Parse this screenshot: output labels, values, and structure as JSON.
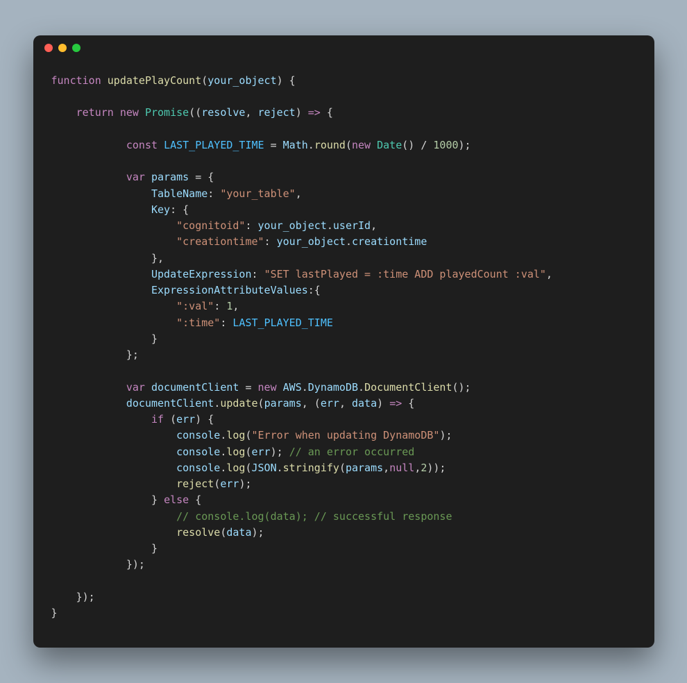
{
  "titlebar": {
    "dots": [
      "red",
      "yellow",
      "green"
    ]
  },
  "code": {
    "t01_kw_function": "function",
    "t02_fn_name": "updatePlayCount",
    "t03_param": "your_object",
    "t04_kw_return": "return",
    "t05_kw_new": "new",
    "t06_cls_promise": "Promise",
    "t07_resolve": "resolve",
    "t08_reject": "reject",
    "t09_kw_const": "const",
    "t10_cst_lpt": "LAST_PLAYED_TIME",
    "t11_id_math": "Math",
    "t12_fn_round": "round",
    "t13_kw_new2": "new",
    "t14_cls_date": "Date",
    "t15_num_1000": "1000",
    "t16_kw_var": "var",
    "t17_id_params": "params",
    "t18_id_tablename": "TableName",
    "t19_str_table": "\"your_table\"",
    "t20_id_key": "Key",
    "t21_str_cognitoid": "\"cognitoid\"",
    "t22_id_yourobj": "your_object",
    "t23_id_userId": "userId",
    "t24_str_creationtime": "\"creationtime\"",
    "t25_id_yourobj2": "your_object",
    "t26_id_creationtime": "creationtime",
    "t27_id_updateexpr": "UpdateExpression",
    "t28_str_updateexpr": "\"SET lastPlayed = :time ADD playedCount :val\"",
    "t29_id_exprattrvals": "ExpressionAttributeValues",
    "t30_str_val": "\":val\"",
    "t31_num_1": "1",
    "t32_str_time": "\":time\"",
    "t33_cst_lpt2": "LAST_PLAYED_TIME",
    "t34_kw_var2": "var",
    "t35_id_docclient": "documentClient",
    "t36_kw_new3": "new",
    "t37_id_aws": "AWS",
    "t38_id_dynamodb": "DynamoDB",
    "t39_fn_docclient": "DocumentClient",
    "t40_id_docclient2": "documentClient",
    "t41_fn_update": "update",
    "t42_id_params2": "params",
    "t43_id_err": "err",
    "t44_id_data": "data",
    "t45_kw_if": "if",
    "t46_id_err2": "err",
    "t47_id_console": "console",
    "t48_fn_log": "log",
    "t49_str_errmsg": "\"Error when updating DynamoDB\"",
    "t50_id_console2": "console",
    "t51_fn_log2": "log",
    "t52_id_err3": "err",
    "t53_cmt_errocc": "// an error occurred",
    "t54_id_console3": "console",
    "t55_fn_log3": "log",
    "t56_id_json": "JSON",
    "t57_fn_stringify": "stringify",
    "t58_id_params3": "params",
    "t59_kw_null": "null",
    "t60_num_2": "2",
    "t61_fn_reject": "reject",
    "t62_id_err4": "err",
    "t63_kw_else": "else",
    "t64_cmt_success": "// console.log(data); // successful response",
    "t65_fn_resolve": "resolve",
    "t66_id_data2": "data"
  }
}
